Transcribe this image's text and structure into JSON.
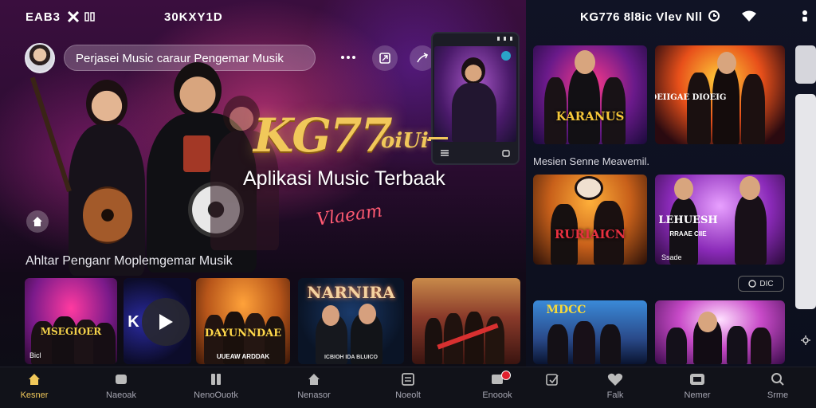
{
  "status_bar": {
    "left_text": "EAB3",
    "mid_text": "30KXY1D",
    "right_text": "KG776 8l8ic  Vlev Nll"
  },
  "top_bar": {
    "search_text": "Perjasei Music caraur Pengemar Musik"
  },
  "hero": {
    "brand": "KG77",
    "brand_suffix": "oiUi",
    "tagline": "Aplikasi Music Terbaak",
    "signature": "Vlaeam"
  },
  "section_title": "Ahltar Penganr Moplemgemar Musik",
  "carousel": [
    {
      "label": "MSEGIOER",
      "sub": "Bicl"
    },
    {
      "label": "K"
    },
    {
      "label": "DAYUNNDAE",
      "sub": "UUEAW ARDDAK"
    },
    {
      "label": "NARNIRA",
      "sub": "ICBIOH IDA BLUICO"
    },
    {
      "label": ""
    }
  ],
  "right_grid": {
    "row1": [
      {
        "label": "KARANUS"
      },
      {
        "label": "DEIIGAE DIOEIG"
      }
    ],
    "row1_caption": "Mesien Senne Meavemil.",
    "row2": [
      {
        "label": "RURIAICN"
      },
      {
        "label": "LEHUESH",
        "sub": "RRAAE  CIIE",
        "tag": "Ssade"
      }
    ],
    "pill_text": "DIC",
    "row3": [
      {
        "label": "MDCC"
      },
      {
        "label": ""
      }
    ]
  },
  "bottom_nav": [
    {
      "label": "Kesner",
      "icon": "home-icon",
      "active": true
    },
    {
      "label": "Naeoak",
      "icon": "album-icon",
      "active": false
    },
    {
      "label": "NenoOuotk",
      "icon": "pause-icon",
      "active": false
    },
    {
      "label": "Nenasor",
      "icon": "house-icon",
      "active": false
    },
    {
      "label": "Noeolt",
      "icon": "list-icon",
      "active": false
    },
    {
      "label": "Enoook",
      "icon": "notification-icon",
      "active": false
    },
    {
      "label": "",
      "icon": "edit-icon",
      "active": false
    },
    {
      "label": "Falk",
      "icon": "heart-icon",
      "active": false
    },
    {
      "label": "Nemer",
      "icon": "tv-icon",
      "active": false
    },
    {
      "label": "Srme",
      "icon": "search-icon",
      "active": false
    }
  ],
  "colors": {
    "accent": "#f1c85a",
    "hero_pink": "#ff4696",
    "badge_red": "#e0202e",
    "nav_bg": "#111219"
  }
}
